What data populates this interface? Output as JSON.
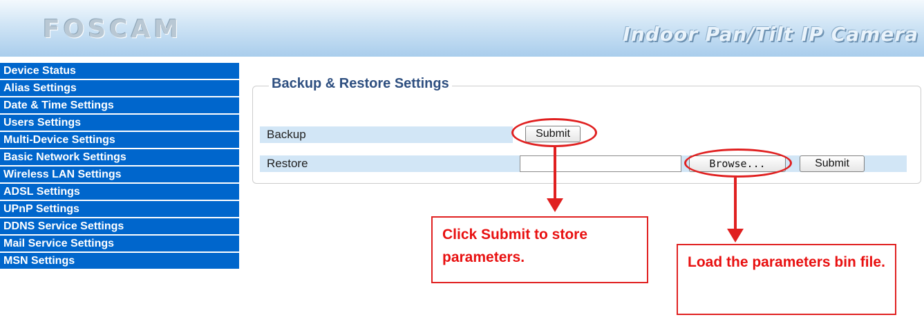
{
  "header": {
    "logo": "FOSCAM",
    "product": "Indoor Pan/Tilt IP Camera"
  },
  "sidebar": {
    "items": [
      {
        "label": "Device Status"
      },
      {
        "label": "Alias Settings"
      },
      {
        "label": "Date & Time Settings"
      },
      {
        "label": "Users Settings"
      },
      {
        "label": "Multi-Device Settings"
      },
      {
        "label": "Basic Network Settings"
      },
      {
        "label": "Wireless LAN Settings"
      },
      {
        "label": "ADSL Settings"
      },
      {
        "label": "UPnP Settings"
      },
      {
        "label": "DDNS Service Settings"
      },
      {
        "label": "Mail Service Settings"
      },
      {
        "label": "MSN Settings"
      }
    ]
  },
  "main": {
    "title": "Backup & Restore Settings",
    "backup": {
      "label": "Backup",
      "submit_label": "Submit"
    },
    "restore": {
      "label": "Restore",
      "file_value": "",
      "browse_label": "Browse...",
      "submit_label": "Submit"
    }
  },
  "annotations": {
    "callout_backup": "Click Submit to store parameters.",
    "callout_restore": "Load the parameters bin file."
  },
  "colors": {
    "sidebar_bg": "#0066cc",
    "title": "#2e4f80",
    "row_bg": "#d2e6f6",
    "annotation": "#e02020"
  }
}
